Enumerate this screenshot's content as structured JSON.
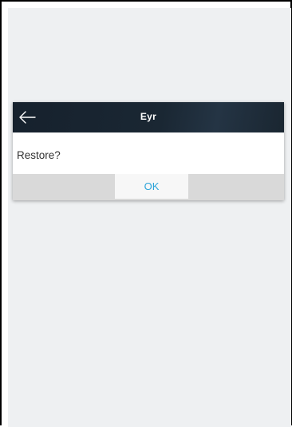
{
  "dialog": {
    "title": "Eyr",
    "message": "Restore?",
    "ok_label": "OK",
    "back_icon": "arrow-left-icon"
  },
  "colors": {
    "header_bg": "#1a2733",
    "accent": "#2aa3d9",
    "footer_bg": "#d9d9d9",
    "screen_bg": "#eef0f2"
  }
}
